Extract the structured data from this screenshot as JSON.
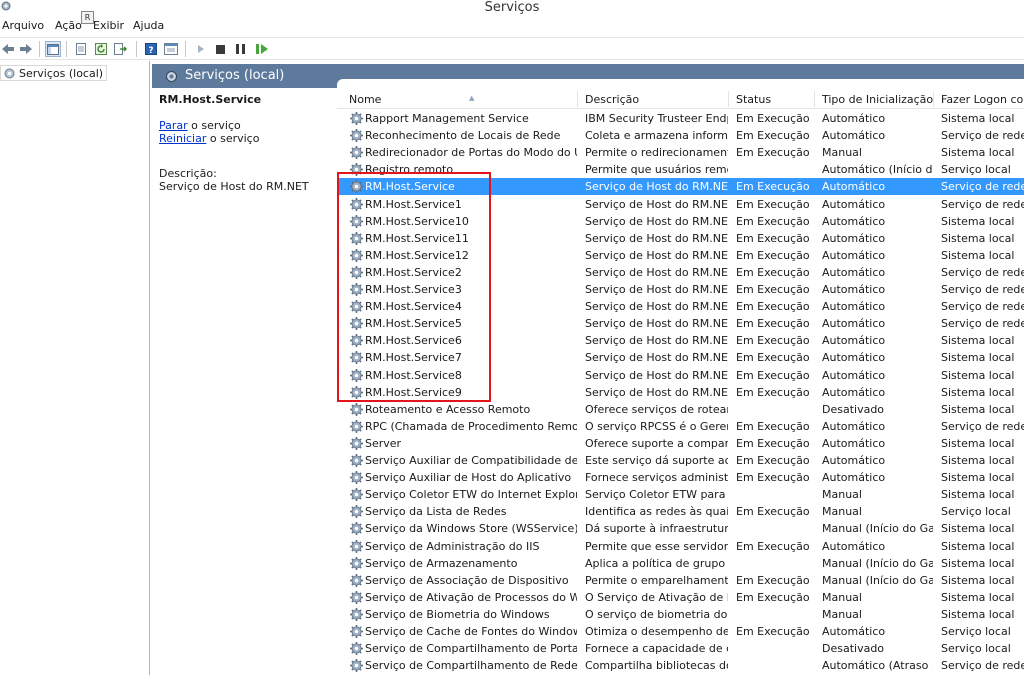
{
  "window": {
    "title": "Serviços",
    "app_icon": "gear-icon"
  },
  "menu": {
    "items": [
      "Arquivo",
      "Ação",
      "Exibir",
      "Ajuda"
    ],
    "tooltip_letter": "R"
  },
  "toolbar": {
    "icons": [
      "back-arrow-icon",
      "forward-arrow-icon",
      "console-tree-icon",
      "properties-icon",
      "refresh-icon",
      "export-list-icon",
      "help-icon",
      "view-icon",
      "play-icon",
      "stop-icon",
      "pause-icon",
      "resume-icon"
    ]
  },
  "tree": {
    "root_label": "Serviços (local)"
  },
  "pane": {
    "title": "Serviços (local)"
  },
  "details": {
    "service_name": "RM.Host.Service",
    "stop_link": "Parar",
    "stop_suffix": " o serviço",
    "restart_link": "Reiniciar",
    "restart_suffix": " o serviço",
    "description_label": "Descrição:",
    "description_text": "Serviço de Host do RM.NET"
  },
  "columns": [
    "Nome",
    "Descrição",
    "Status",
    "Tipo de Inicialização",
    "Fazer Logon como"
  ],
  "selected_index": 4,
  "rows": [
    {
      "name": "Rapport Management Service",
      "desc": "IBM Security Trusteer Endp...",
      "status": "Em Execução",
      "start": "Automático",
      "logon": "Sistema local"
    },
    {
      "name": "Reconhecimento de Locais de Rede",
      "desc": "Coleta e armazena informa...",
      "status": "Em Execução",
      "start": "Automático",
      "logon": "Serviço de rede"
    },
    {
      "name": "Redirecionador de Portas do Modo do Usu...",
      "desc": "Permite o redirecionament...",
      "status": "Em Execução",
      "start": "Manual",
      "logon": "Sistema local"
    },
    {
      "name": "Registro remoto",
      "desc": "Permite que usuários remot...",
      "status": "",
      "start": "Automático (Início d...",
      "logon": "Serviço local"
    },
    {
      "name": "RM.Host.Service",
      "desc": "Serviço de Host do RM.NET",
      "status": "Em Execução",
      "start": "Automático",
      "logon": "Serviço de rede"
    },
    {
      "name": "RM.Host.Service1",
      "desc": "Serviço de Host do RM.NET",
      "status": "Em Execução",
      "start": "Automático",
      "logon": "Serviço de rede"
    },
    {
      "name": "RM.Host.Service10",
      "desc": "Serviço de Host do RM.NET",
      "status": "Em Execução",
      "start": "Automático",
      "logon": "Sistema local"
    },
    {
      "name": "RM.Host.Service11",
      "desc": "Serviço de Host do RM.NET",
      "status": "Em Execução",
      "start": "Automático",
      "logon": "Sistema local"
    },
    {
      "name": "RM.Host.Service12",
      "desc": "Serviço de Host do RM.NET",
      "status": "Em Execução",
      "start": "Automático",
      "logon": "Sistema local"
    },
    {
      "name": "RM.Host.Service2",
      "desc": "Serviço de Host do RM.NET",
      "status": "Em Execução",
      "start": "Automático",
      "logon": "Serviço de rede"
    },
    {
      "name": "RM.Host.Service3",
      "desc": "Serviço de Host do RM.NET",
      "status": "Em Execução",
      "start": "Automático",
      "logon": "Serviço de rede"
    },
    {
      "name": "RM.Host.Service4",
      "desc": "Serviço de Host do RM.NET",
      "status": "Em Execução",
      "start": "Automático",
      "logon": "Serviço de rede"
    },
    {
      "name": "RM.Host.Service5",
      "desc": "Serviço de Host do RM.NET",
      "status": "Em Execução",
      "start": "Automático",
      "logon": "Serviço de rede"
    },
    {
      "name": "RM.Host.Service6",
      "desc": "Serviço de Host do RM.NET",
      "status": "Em Execução",
      "start": "Automático",
      "logon": "Sistema local"
    },
    {
      "name": "RM.Host.Service7",
      "desc": "Serviço de Host do RM.NET",
      "status": "Em Execução",
      "start": "Automático",
      "logon": "Sistema local"
    },
    {
      "name": "RM.Host.Service8",
      "desc": "Serviço de Host do RM.NET",
      "status": "Em Execução",
      "start": "Automático",
      "logon": "Sistema local"
    },
    {
      "name": "RM.Host.Service9",
      "desc": "Serviço de Host do RM.NET",
      "status": "Em Execução",
      "start": "Automático",
      "logon": "Sistema local"
    },
    {
      "name": "Roteamento e Acesso Remoto",
      "desc": "Oferece serviços de roteam...",
      "status": "",
      "start": "Desativado",
      "logon": "Sistema local"
    },
    {
      "name": "RPC (Chamada de Procedimento Remoto)",
      "desc": "O serviço RPCSS é o Gerenc...",
      "status": "Em Execução",
      "start": "Automático",
      "logon": "Serviço de rede"
    },
    {
      "name": "Server",
      "desc": "Oferece suporte a comparti...",
      "status": "Em Execução",
      "start": "Automático",
      "logon": "Sistema local"
    },
    {
      "name": "Serviço Auxiliar de Compatibilidade de Pro...",
      "desc": "Este serviço dá suporte ao P...",
      "status": "Em Execução",
      "start": "Automático",
      "logon": "Sistema local"
    },
    {
      "name": "Serviço Auxiliar de Host do Aplicativo",
      "desc": "Fornece serviços administra...",
      "status": "Em Execução",
      "start": "Automático",
      "logon": "Sistema local"
    },
    {
      "name": "Serviço Coletor ETW do Internet Explorer",
      "desc": "Serviço Coletor ETW para o ...",
      "status": "",
      "start": "Manual",
      "logon": "Sistema local"
    },
    {
      "name": "Serviço da Lista de Redes",
      "desc": "Identifica as redes às quais ...",
      "status": "Em Execução",
      "start": "Manual",
      "logon": "Serviço local"
    },
    {
      "name": "Serviço da Windows Store (WSService)",
      "desc": "Dá suporte à infraestrutura ...",
      "status": "",
      "start": "Manual (Início do Ga...",
      "logon": "Sistema local"
    },
    {
      "name": "Serviço de Administração do IIS",
      "desc": "Permite que esse servidor a...",
      "status": "Em Execução",
      "start": "Automático",
      "logon": "Sistema local"
    },
    {
      "name": "Serviço de Armazenamento",
      "desc": "Aplica a política de grupo p...",
      "status": "",
      "start": "Manual (Início do Ga...",
      "logon": "Sistema local"
    },
    {
      "name": "Serviço de Associação de Dispositivo",
      "desc": "Permite o emparelhamento...",
      "status": "Em Execução",
      "start": "Manual (Início do Ga...",
      "logon": "Sistema local"
    },
    {
      "name": "Serviço de Ativação de Processos do Wind...",
      "desc": "O Serviço de Ativação de Pr...",
      "status": "Em Execução",
      "start": "Manual",
      "logon": "Sistema local"
    },
    {
      "name": "Serviço de Biometria do Windows",
      "desc": "O serviço de biometria do ...",
      "status": "",
      "start": "Manual",
      "logon": "Sistema local"
    },
    {
      "name": "Serviço de Cache de Fontes do Windows",
      "desc": "Otimiza o desempenho de ...",
      "status": "Em Execução",
      "start": "Automático",
      "logon": "Serviço local"
    },
    {
      "name": "Serviço de Compartilhamento de Porta Net...",
      "desc": "Fornece a capacidade de co...",
      "status": "",
      "start": "Desativado",
      "logon": "Serviço local"
    },
    {
      "name": "Serviço de Compartilhamento de Rede do ...",
      "desc": "Compartilha bibliotecas do ...",
      "status": "",
      "start": "Automático (Atraso ...",
      "logon": "Serviço de rede"
    }
  ],
  "colors": {
    "header_bar": "#5d7a9c",
    "selection": "#3399ff",
    "link": "#0033cc",
    "annotation_box": "#e3141b"
  }
}
